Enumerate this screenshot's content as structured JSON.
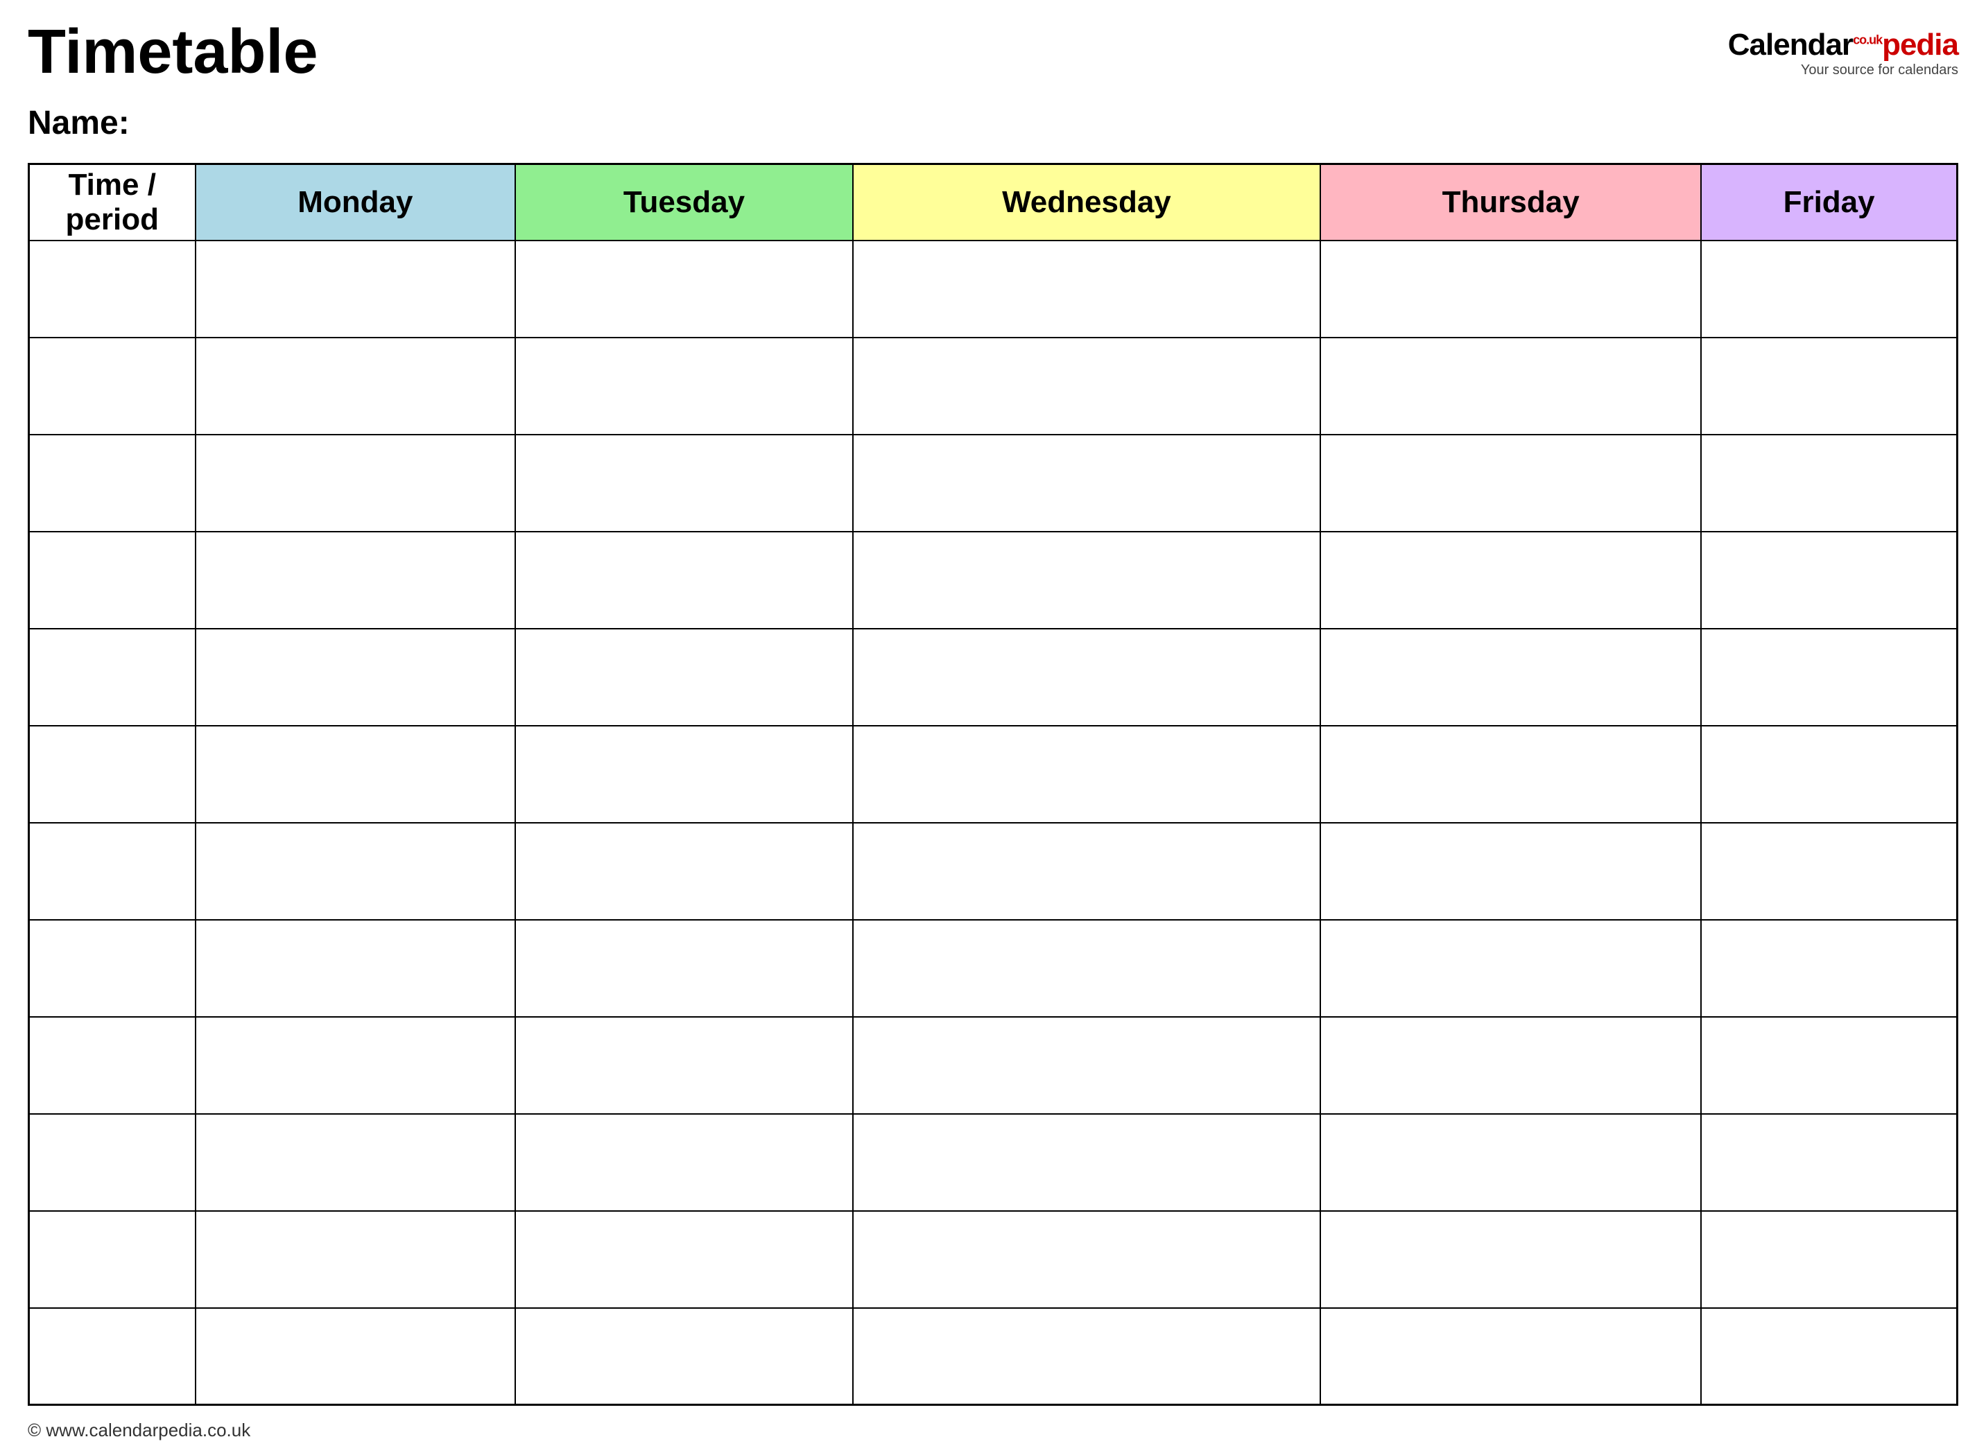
{
  "header": {
    "title": "Timetable",
    "logo": {
      "brand_calendar": "Calendar",
      "brand_couk": "co.uk",
      "brand_pedia": "pedia",
      "tagline": "Your source for calendars"
    }
  },
  "name_label": "Name:",
  "table": {
    "columns": [
      {
        "id": "time",
        "label": "Time / period",
        "color": "#ffffff"
      },
      {
        "id": "monday",
        "label": "Monday",
        "color": "#add8e6"
      },
      {
        "id": "tuesday",
        "label": "Tuesday",
        "color": "#90ee90"
      },
      {
        "id": "wednesday",
        "label": "Wednesday",
        "color": "#ffff99"
      },
      {
        "id": "thursday",
        "label": "Thursday",
        "color": "#ffb6c1"
      },
      {
        "id": "friday",
        "label": "Friday",
        "color": "#d8b4fe"
      }
    ],
    "row_count": 12
  },
  "footer": {
    "url": "© www.calendarpedia.co.uk"
  }
}
